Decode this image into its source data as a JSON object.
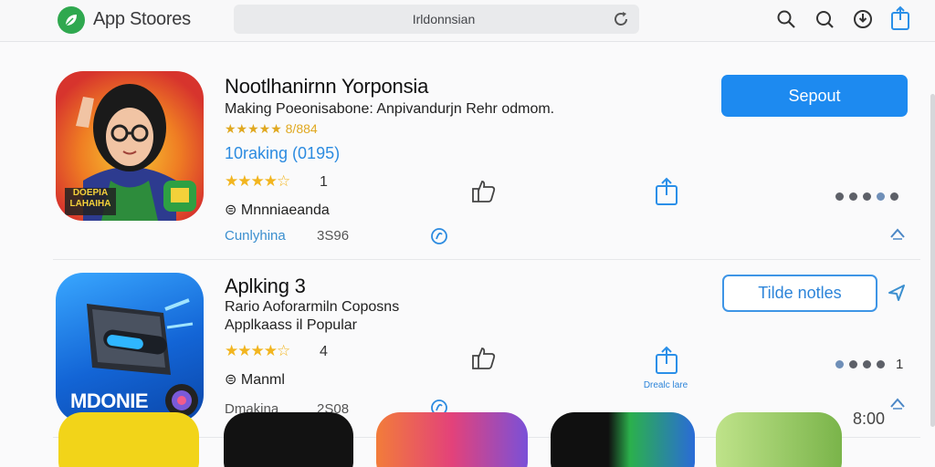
{
  "header": {
    "app_title": "App Stoores",
    "search_value": "Irldonnsian",
    "icons": [
      "leaf-logo-icon",
      "refresh-icon",
      "search-icon",
      "magnifier-icon",
      "download-icon",
      "share-icon"
    ]
  },
  "apps": [
    {
      "name": "Nootlhanirnn  Yorponsia",
      "subtitle": "Making Poeonisabone: Anpivandurjn Rehr odmom.",
      "rating_text": "★★★★★ 8/884",
      "ranking": "10raking (0195)",
      "stars": "★★★★☆",
      "rating_count": "1",
      "developer": "Mnnniaeanda",
      "category": "Cunlyhina",
      "size": "3S96",
      "action_label": "Sepout",
      "tile_text": "DOEPIA\nLAHAIHA",
      "colors": {
        "accent": "#1d8af0"
      }
    },
    {
      "name": "Aplking 3",
      "subtitle": "Rario Aoforarmiln Coposns",
      "subtitle2": "Applkaass il Popular",
      "stars": "★★★★☆",
      "rating_count": "4",
      "developer": "Manml",
      "category": "Dmakina",
      "size": "2S08",
      "action_label": "Tilde notles",
      "share_label": "Drealc lare",
      "tile_text": "MDONIE",
      "page_num": "1",
      "colors": {
        "accent": "#2c84d9"
      }
    }
  ],
  "status": {
    "time": "8:00"
  }
}
